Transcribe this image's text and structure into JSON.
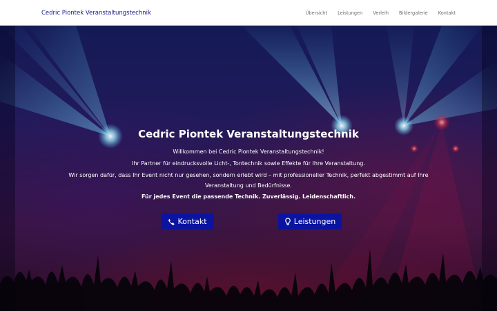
{
  "nav": {
    "brand": "Cedric Piontek Veranstaltungstechnik",
    "links": [
      "Übersicht",
      "Leistungen",
      "Verleih",
      "Bildergalerie",
      "Kontakt"
    ]
  },
  "hero": {
    "title": "Cedric Piontek Veranstaltungstechnik",
    "p1": "Willkommen bei Cedric Piontek Veranstaltungstechnik!",
    "p2": "Ihr Partner für eindrucksvolle Licht-, Tontechnik sowie Effekte für Ihre Veranstaltung.",
    "p3": "Wir sorgen dafür, dass Ihr Event nicht nur gesehen, sondern erlebt wird – mit professioneller Technik, perfekt abgestimmt auf Ihre Veranstaltung und Bedürfnisse.",
    "tagline": "Für jedes Event die passende Technik. Zuverlässig. Leidenschaftlich.",
    "buttons": {
      "kontakt": {
        "label": "Kontakt",
        "icon": "phone-icon"
      },
      "leistungen": {
        "label": "Leistungen",
        "icon": "lightbulb-icon"
      }
    }
  },
  "colors": {
    "brand": "#1a1a8c",
    "button_bg": "#0b14a0",
    "beam": "#4fc3f7"
  }
}
